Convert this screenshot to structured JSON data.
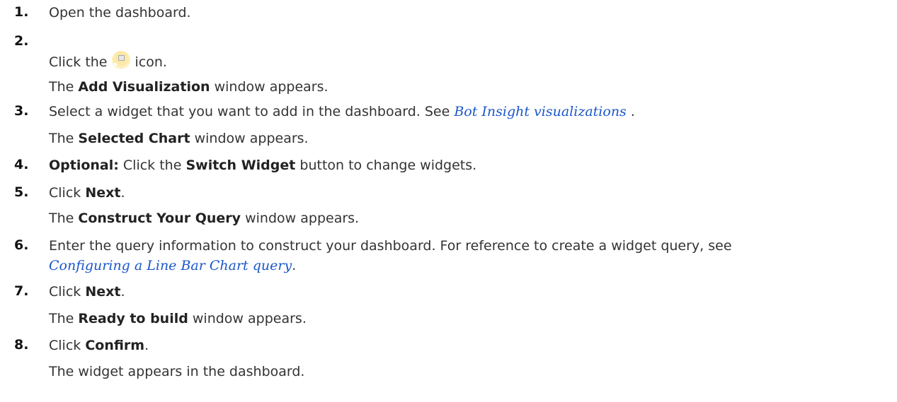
{
  "steps": [
    {
      "number": "1.",
      "text": "Open the dashboard."
    },
    {
      "number": "2.",
      "pre": "Click the",
      "icon": "add-visualization-icon",
      "post": "icon.",
      "result_pre": "The",
      "result_bold": "Add Visualization",
      "result_post": "window appears."
    },
    {
      "number": "3.",
      "text": "Select a widget that you want to add in the dashboard. See",
      "link": "Bot Insight visualizations",
      "after_link": ".",
      "result_pre": "The",
      "result_bold": "Selected Chart",
      "result_post": "window appears."
    },
    {
      "number": "4.",
      "optional": "Optional:",
      "pre": "Click the",
      "bold": "Switch Widget",
      "post": "button to change widgets."
    },
    {
      "number": "5.",
      "pre": "Click",
      "bold": "Next",
      "post": ".",
      "result_pre": "The",
      "result_bold": "Construct Your Query",
      "result_post": "window appears."
    },
    {
      "number": "6.",
      "text": "Enter the query information to construct your dashboard. For reference to create a widget query, see",
      "link": "Configuring a Line Bar Chart query",
      "after_link": "."
    },
    {
      "number": "7.",
      "pre": "Click",
      "bold": "Next",
      "post": ".",
      "result_pre": "The",
      "result_bold": "Ready to build",
      "result_post": "window appears."
    },
    {
      "number": "8.",
      "pre": "Click",
      "bold": "Confirm",
      "post": ".",
      "result": "The widget appears in the dashboard."
    }
  ]
}
